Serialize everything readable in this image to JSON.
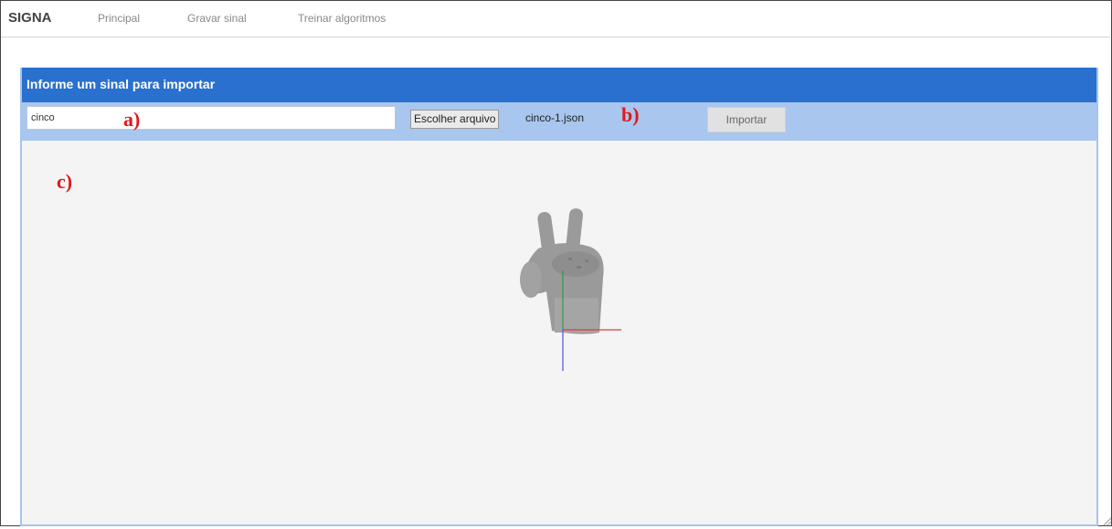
{
  "navbar": {
    "brand": "SIGNA",
    "links": [
      "Principal",
      "Gravar sinal",
      "Treinar algoritmos"
    ]
  },
  "panel": {
    "title": "Informe um sinal para importar",
    "name_input_value": "cinco",
    "file_button_label": "Escolher arquivo",
    "file_name": "cinco-1.json",
    "import_button_label": "Importar"
  },
  "annotations": {
    "a": "a)",
    "b": "b)",
    "c": "c)"
  },
  "viewer": {
    "content": "3d-hand-model",
    "axis_colors": {
      "x": "#e23b3b",
      "y": "#3a9b4a",
      "z": "#5a5af0"
    }
  },
  "colors": {
    "header_bg": "#2970cf",
    "toolbar_bg": "#a8c6ee",
    "viewer_bg": "#f4f4f4",
    "annotation": "#e2181a"
  }
}
